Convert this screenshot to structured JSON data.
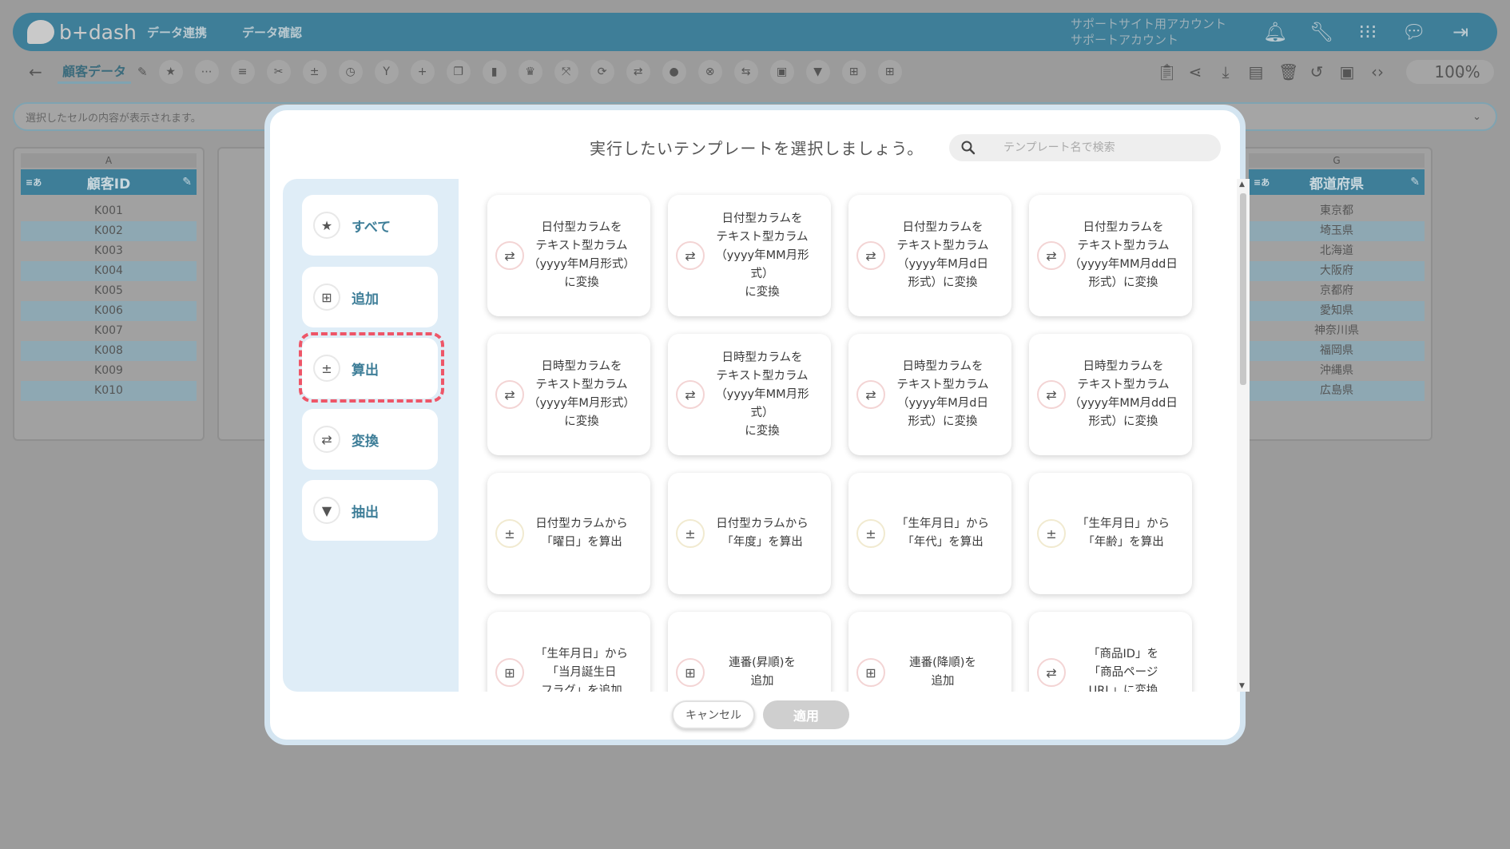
{
  "app": {
    "logo_text": "b+dash",
    "nav": [
      "データ連携",
      "データ確認"
    ],
    "account_line1": "サポートサイト用アカウント",
    "account_line2": "サポートアカウント"
  },
  "toolbar": {
    "doc_name": "顧客データ",
    "zoom": "100%"
  },
  "cell_bar": {
    "placeholder": "選択したセルの内容が表示されます。"
  },
  "columns": [
    {
      "letter": "A",
      "type_tag": "≡あ",
      "header": "顧客ID",
      "cells": [
        "K001",
        "K002",
        "K003",
        "K004",
        "K005",
        "K006",
        "K007",
        "K008",
        "K009",
        "K010"
      ]
    },
    {
      "letter": "G",
      "type_tag": "≡あ",
      "header": "都道府県",
      "cells": [
        "東京都",
        "埼玉県",
        "北海道",
        "大阪府",
        "京都府",
        "愛知県",
        "神奈川県",
        "福岡県",
        "沖縄県",
        "広島県"
      ]
    }
  ],
  "modal": {
    "title": "実行したいテンプレートを選択しましょう。",
    "search_placeholder": "テンプレート名で検索",
    "categories": [
      {
        "label": "すべて",
        "icon": "star-icon"
      },
      {
        "label": "追加",
        "icon": "plus-box-icon"
      },
      {
        "label": "算出",
        "icon": "calculator-icon"
      },
      {
        "label": "変換",
        "icon": "convert-icon"
      },
      {
        "label": "抽出",
        "icon": "filter-icon"
      }
    ],
    "selected_category": "算出",
    "cards": [
      {
        "text": "日付型カラムを\nテキスト型カラム\n（yyyy年M月形式）\nに変換",
        "icon": "convert-icon"
      },
      {
        "text": "日付型カラムを\nテキスト型カラム\n（yyyy年MM月形式）\nに変換",
        "icon": "convert-icon"
      },
      {
        "text": "日付型カラムを\nテキスト型カラム\n（yyyy年M月d日\n形式）に変換",
        "icon": "convert-icon"
      },
      {
        "text": "日付型カラムを\nテキスト型カラム\n（yyyy年MM月dd日\n形式）に変換",
        "icon": "convert-icon"
      },
      {
        "text": "日時型カラムを\nテキスト型カラム\n（yyyy年M月形式）\nに変換",
        "icon": "convert-icon"
      },
      {
        "text": "日時型カラムを\nテキスト型カラム\n（yyyy年MM月形式）\nに変換",
        "icon": "convert-icon"
      },
      {
        "text": "日時型カラムを\nテキスト型カラム\n（yyyy年M月d日\n形式）に変換",
        "icon": "convert-icon"
      },
      {
        "text": "日時型カラムを\nテキスト型カラム\n（yyyy年MM月dd日\n形式）に変換",
        "icon": "convert-icon"
      },
      {
        "text": "日付型カラムから\n「曜日」を算出",
        "icon": "calculator-icon"
      },
      {
        "text": "日付型カラムから\n「年度」を算出",
        "icon": "calculator-icon"
      },
      {
        "text": "「生年月日」から\n「年代」を算出",
        "icon": "calculator-icon"
      },
      {
        "text": "「生年月日」から\n「年齢」を算出",
        "icon": "calculator-icon"
      },
      {
        "text": "「生年月日」から\n「当月誕生日\nフラグ」を追加",
        "icon": "plus-box-icon"
      },
      {
        "text": "連番(昇順)を\n追加",
        "icon": "plus-box-icon"
      },
      {
        "text": "連番(降順)を\n追加",
        "icon": "plus-box-icon"
      },
      {
        "text": "「商品ID」を\n「商品ページ\nURL」に変換",
        "icon": "convert-icon"
      }
    ],
    "cancel_label": "キャンセル",
    "apply_label": "適用"
  },
  "colors": {
    "brand": "#3e7e98",
    "highlight": "#ee5668",
    "sidebar_bg": "#dfedf7"
  }
}
